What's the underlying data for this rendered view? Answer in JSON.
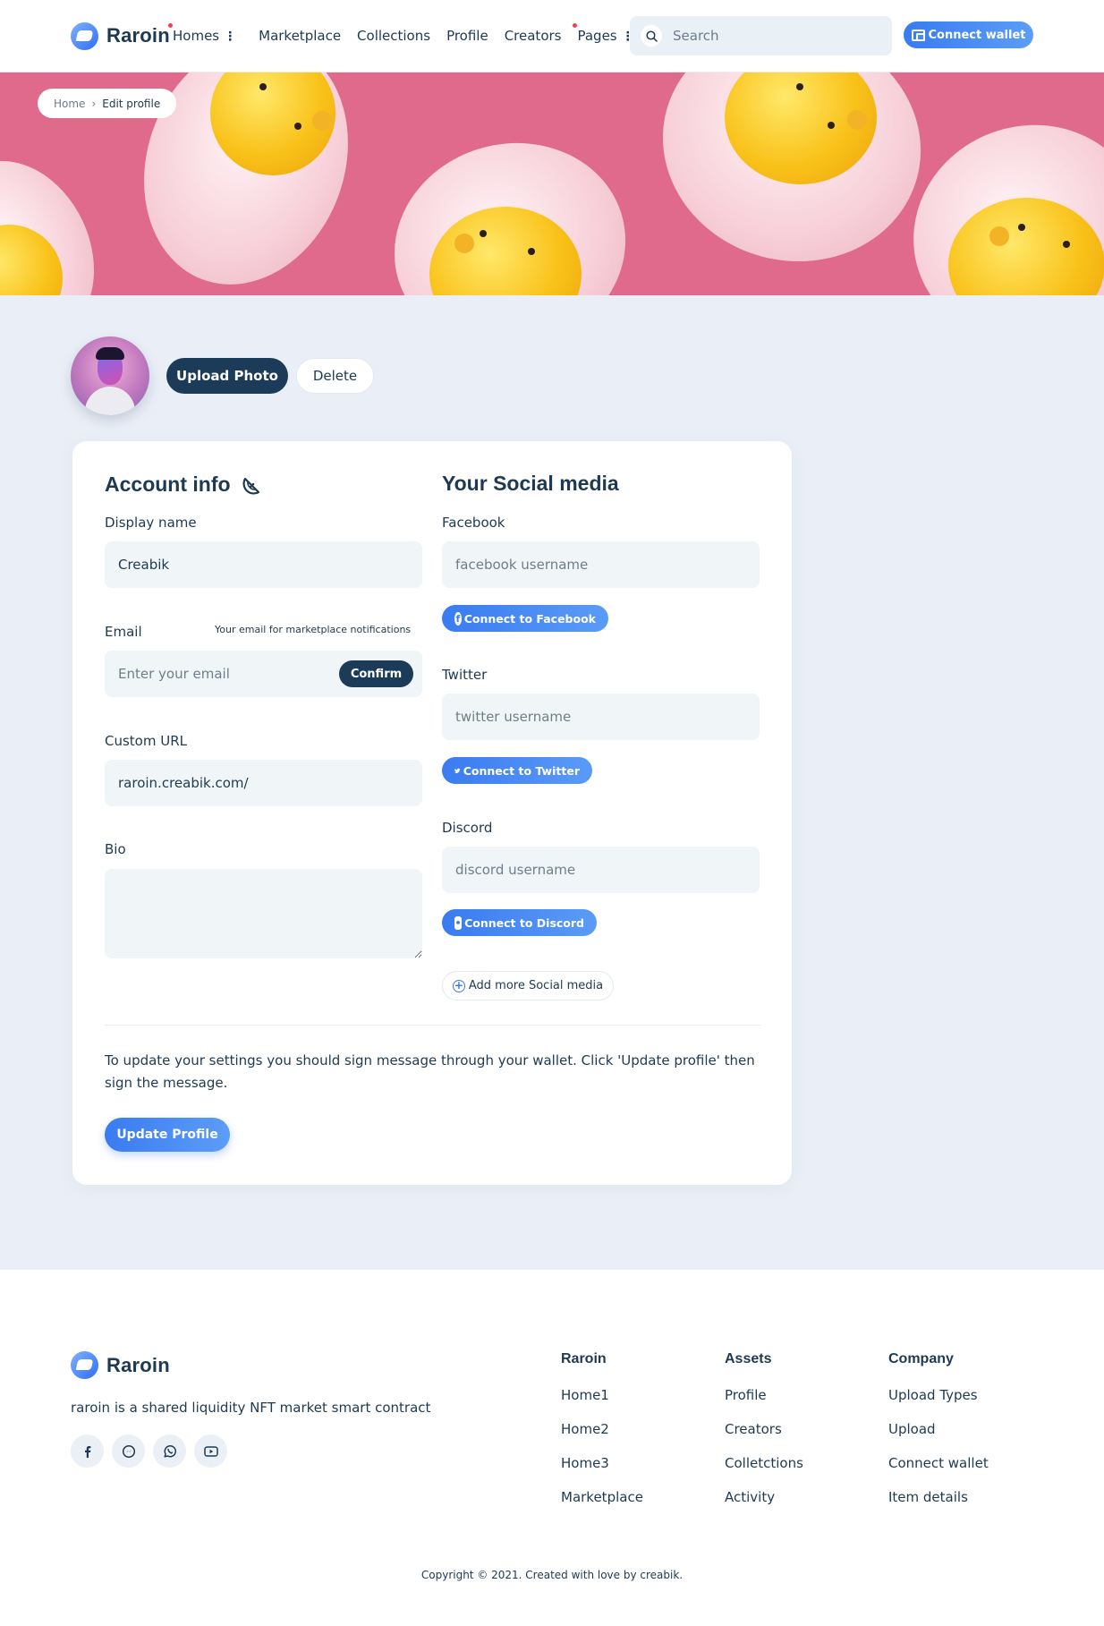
{
  "brand": {
    "name": "Raroin"
  },
  "nav": {
    "items": [
      {
        "label": "Homes",
        "dropdown": true,
        "dot": true
      },
      {
        "label": "Marketplace",
        "dropdown": false,
        "dot": false
      },
      {
        "label": "Collections",
        "dropdown": false,
        "dot": false
      },
      {
        "label": "Profile",
        "dropdown": false,
        "dot": false
      },
      {
        "label": "Creators",
        "dropdown": false,
        "dot": false
      },
      {
        "label": "Pages",
        "dropdown": true,
        "dot": true
      }
    ],
    "search_placeholder": "Search",
    "connect_wallet": "Connect wallet"
  },
  "breadcrumb": {
    "home": "Home",
    "current": "Edit profile"
  },
  "profile_photo": {
    "upload": "Upload Photo",
    "delete": "Delete"
  },
  "account": {
    "title": "Account info",
    "display_name_label": "Display name",
    "display_name_value": "Creabik",
    "email_label": "Email",
    "email_hint": "Your email for marketplace notifications",
    "email_placeholder": "Enter your email",
    "confirm": "Confirm",
    "custom_url_label": "Custom URL",
    "custom_url_value": "raroin.creabik.com/",
    "bio_label": "Bio",
    "bio_value": ""
  },
  "social": {
    "title": "Your Social media",
    "facebook_label": "Facebook",
    "facebook_placeholder": "facebook username",
    "facebook_button": "Connect to Facebook",
    "twitter_label": "Twitter",
    "twitter_placeholder": "twitter username",
    "twitter_button": "Connect to Twitter",
    "discord_label": "Discord",
    "discord_placeholder": "discord username",
    "discord_button": "Connect to Discord",
    "add_more": "Add more Social media"
  },
  "update": {
    "note": "To update your settings you should sign message through your wallet. Click 'Update profile' then sign the message.",
    "button": "Update Profile"
  },
  "footer": {
    "tagline": "raroin is a shared liquidity NFT market smart contract",
    "socials": [
      "facebook-icon",
      "messenger-icon",
      "whatsapp-icon",
      "youtube-icon"
    ],
    "columns": [
      {
        "title": "Raroin",
        "links": [
          "Home1",
          "Home2",
          "Home3",
          "Marketplace"
        ]
      },
      {
        "title": "Assets",
        "links": [
          "Profile",
          "Creators",
          "Colletctions",
          "Activity"
        ]
      },
      {
        "title": "Company",
        "links": [
          "Upload Types",
          "Upload",
          "Connect wallet",
          "Item details"
        ]
      }
    ],
    "copyright": "Copyright © 2021. Created with love by creabik."
  },
  "colors": {
    "primary": "#1b3b59",
    "accent": "#3a7bf0",
    "page_bg": "#eaeff7",
    "banner_pink": "#e06a8b",
    "text": "#1e3a52"
  }
}
